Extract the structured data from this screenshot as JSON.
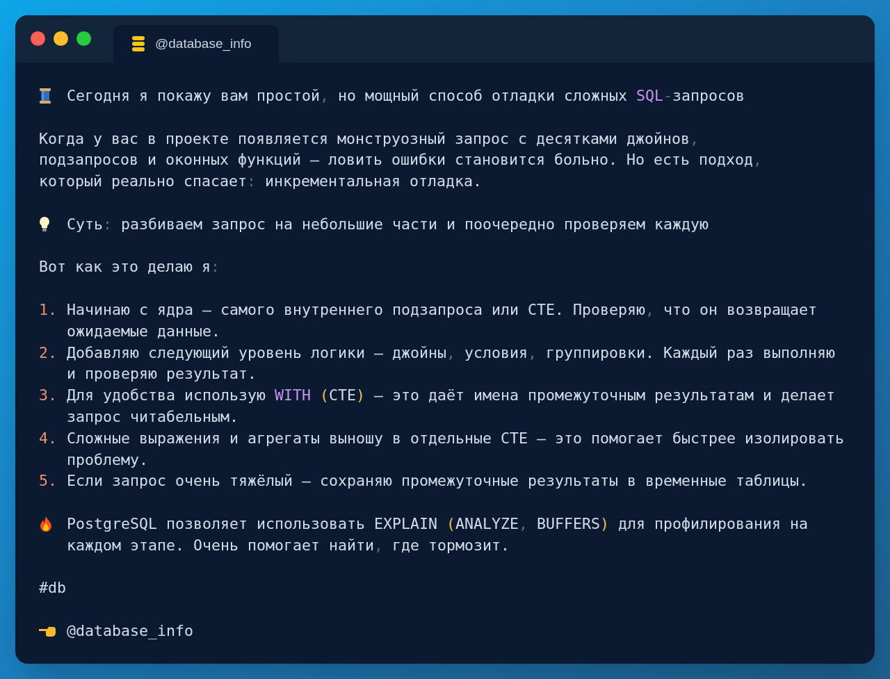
{
  "window": {
    "tab": {
      "title": "@database_info",
      "selected": true
    }
  },
  "blocks": [
    {
      "kind": "headline",
      "lines": [
        [
          {
            "kind": "text",
            "text": "Сегодня я покажу вам простой"
          },
          {
            "kind": "punct",
            "text": ","
          },
          {
            "kind": "text",
            "text": " но мощный способ отладки сложных "
          },
          {
            "kind": "keyword",
            "text": "SQL"
          },
          {
            "kind": "punct",
            "text": "-"
          },
          {
            "kind": "text",
            "text": "запросов"
          }
        ]
      ]
    },
    {
      "kind": "plain",
      "lines": [
        [
          {
            "kind": "text",
            "text": "Когда у вас в проекте появляется монструозный запрос с десятками джойнов"
          },
          {
            "kind": "punct",
            "text": ","
          }
        ],
        [
          {
            "kind": "text",
            "text": "подзапросов и оконных функций — ловить ошибки становится больно. Но есть подход"
          },
          {
            "kind": "punct",
            "text": ","
          }
        ],
        [
          {
            "kind": "text",
            "text": "который реально спасает"
          },
          {
            "kind": "punct",
            "text": ":"
          },
          {
            "kind": "text",
            "text": " инкрементальная отладка."
          }
        ]
      ]
    },
    {
      "kind": "tip",
      "lines": [
        [
          {
            "kind": "text",
            "text": "Суть"
          },
          {
            "kind": "punct",
            "text": ":"
          },
          {
            "kind": "text",
            "text": " разбиваем запрос на небольшие части и поочередно проверяем каждую"
          }
        ]
      ]
    },
    {
      "kind": "plain",
      "lines": [
        [
          {
            "kind": "text",
            "text": "Вот как это делаю я"
          },
          {
            "kind": "punct",
            "text": ":"
          }
        ]
      ]
    },
    {
      "kind": "list",
      "items": [
        {
          "number": "1.",
          "lines": [
            [
              {
                "kind": "text",
                "text": "Начинаю с ядра — самого внутреннего подзапроса или CTE. Проверяю"
              },
              {
                "kind": "punct",
                "text": ","
              },
              {
                "kind": "text",
                "text": " что он возвращает"
              }
            ],
            [
              {
                "kind": "text",
                "text": "ожидаемые данные."
              }
            ]
          ]
        },
        {
          "number": "2.",
          "lines": [
            [
              {
                "kind": "text",
                "text": "Добавляю следующий уровень логики — джойны"
              },
              {
                "kind": "punct",
                "text": ","
              },
              {
                "kind": "text",
                "text": " условия"
              },
              {
                "kind": "punct",
                "text": ","
              },
              {
                "kind": "text",
                "text": " группировки. Каждый раз выполняю"
              }
            ],
            [
              {
                "kind": "text",
                "text": "и проверяю результат."
              }
            ]
          ]
        },
        {
          "number": "3.",
          "lines": [
            [
              {
                "kind": "text",
                "text": "Для удобства использую "
              },
              {
                "kind": "keyword",
                "text": "WITH"
              },
              {
                "kind": "paren",
                "text": " ("
              },
              {
                "kind": "text",
                "text": "CTE"
              },
              {
                "kind": "paren",
                "text": ")"
              },
              {
                "kind": "text",
                "text": " — это даёт имена промежуточным результатам и делает"
              }
            ],
            [
              {
                "kind": "text",
                "text": "запрос читабельным."
              }
            ]
          ]
        },
        {
          "number": "4.",
          "lines": [
            [
              {
                "kind": "text",
                "text": "Сложные выражения и агрегаты выношу в отдельные CTE — это помогает быстрее изолировать"
              }
            ],
            [
              {
                "kind": "text",
                "text": "проблему."
              }
            ]
          ]
        },
        {
          "number": "5.",
          "lines": [
            [
              {
                "kind": "text",
                "text": "Если запрос очень тяжёлый — сохраняю промежуточные результаты в временные таблицы."
              }
            ]
          ]
        }
      ]
    },
    {
      "kind": "note",
      "lines": [
        [
          {
            "kind": "text",
            "text": "PostgreSQL позволяет использовать EXPLAIN "
          },
          {
            "kind": "paren",
            "text": "("
          },
          {
            "kind": "text",
            "text": "ANALYZE"
          },
          {
            "kind": "punct",
            "text": ","
          },
          {
            "kind": "text",
            "text": " BUFFERS"
          },
          {
            "kind": "paren",
            "text": ")"
          },
          {
            "kind": "text",
            "text": " для профилирования на"
          }
        ],
        [
          {
            "kind": "text",
            "text": "каждом этапе. Очень помогает найти"
          },
          {
            "kind": "punct",
            "text": ","
          },
          {
            "kind": "text",
            "text": " где тормозит."
          }
        ]
      ]
    },
    {
      "kind": "plain",
      "lines": [
        [
          {
            "kind": "text",
            "text": "#db"
          }
        ]
      ]
    },
    {
      "kind": "signature",
      "lines": [
        [
          {
            "kind": "text",
            "text": "@database_info"
          }
        ]
      ]
    }
  ]
}
